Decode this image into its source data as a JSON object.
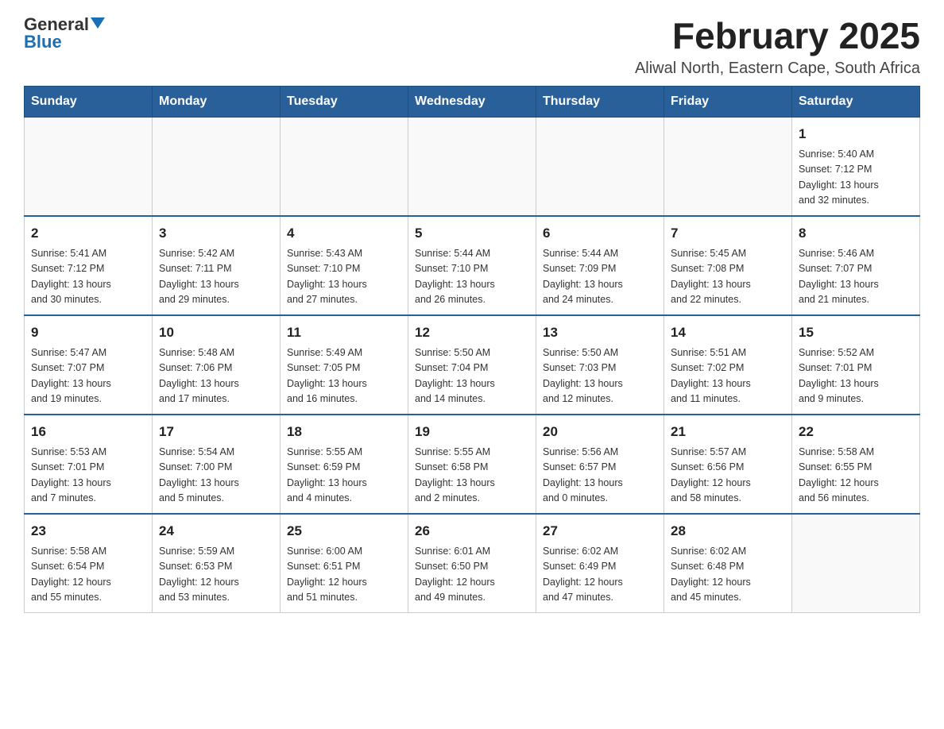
{
  "logo": {
    "general": "General",
    "blue": "Blue"
  },
  "title": "February 2025",
  "subtitle": "Aliwal North, Eastern Cape, South Africa",
  "weekdays": [
    "Sunday",
    "Monday",
    "Tuesday",
    "Wednesday",
    "Thursday",
    "Friday",
    "Saturday"
  ],
  "weeks": [
    [
      {
        "day": "",
        "info": ""
      },
      {
        "day": "",
        "info": ""
      },
      {
        "day": "",
        "info": ""
      },
      {
        "day": "",
        "info": ""
      },
      {
        "day": "",
        "info": ""
      },
      {
        "day": "",
        "info": ""
      },
      {
        "day": "1",
        "info": "Sunrise: 5:40 AM\nSunset: 7:12 PM\nDaylight: 13 hours\nand 32 minutes."
      }
    ],
    [
      {
        "day": "2",
        "info": "Sunrise: 5:41 AM\nSunset: 7:12 PM\nDaylight: 13 hours\nand 30 minutes."
      },
      {
        "day": "3",
        "info": "Sunrise: 5:42 AM\nSunset: 7:11 PM\nDaylight: 13 hours\nand 29 minutes."
      },
      {
        "day": "4",
        "info": "Sunrise: 5:43 AM\nSunset: 7:10 PM\nDaylight: 13 hours\nand 27 minutes."
      },
      {
        "day": "5",
        "info": "Sunrise: 5:44 AM\nSunset: 7:10 PM\nDaylight: 13 hours\nand 26 minutes."
      },
      {
        "day": "6",
        "info": "Sunrise: 5:44 AM\nSunset: 7:09 PM\nDaylight: 13 hours\nand 24 minutes."
      },
      {
        "day": "7",
        "info": "Sunrise: 5:45 AM\nSunset: 7:08 PM\nDaylight: 13 hours\nand 22 minutes."
      },
      {
        "day": "8",
        "info": "Sunrise: 5:46 AM\nSunset: 7:07 PM\nDaylight: 13 hours\nand 21 minutes."
      }
    ],
    [
      {
        "day": "9",
        "info": "Sunrise: 5:47 AM\nSunset: 7:07 PM\nDaylight: 13 hours\nand 19 minutes."
      },
      {
        "day": "10",
        "info": "Sunrise: 5:48 AM\nSunset: 7:06 PM\nDaylight: 13 hours\nand 17 minutes."
      },
      {
        "day": "11",
        "info": "Sunrise: 5:49 AM\nSunset: 7:05 PM\nDaylight: 13 hours\nand 16 minutes."
      },
      {
        "day": "12",
        "info": "Sunrise: 5:50 AM\nSunset: 7:04 PM\nDaylight: 13 hours\nand 14 minutes."
      },
      {
        "day": "13",
        "info": "Sunrise: 5:50 AM\nSunset: 7:03 PM\nDaylight: 13 hours\nand 12 minutes."
      },
      {
        "day": "14",
        "info": "Sunrise: 5:51 AM\nSunset: 7:02 PM\nDaylight: 13 hours\nand 11 minutes."
      },
      {
        "day": "15",
        "info": "Sunrise: 5:52 AM\nSunset: 7:01 PM\nDaylight: 13 hours\nand 9 minutes."
      }
    ],
    [
      {
        "day": "16",
        "info": "Sunrise: 5:53 AM\nSunset: 7:01 PM\nDaylight: 13 hours\nand 7 minutes."
      },
      {
        "day": "17",
        "info": "Sunrise: 5:54 AM\nSunset: 7:00 PM\nDaylight: 13 hours\nand 5 minutes."
      },
      {
        "day": "18",
        "info": "Sunrise: 5:55 AM\nSunset: 6:59 PM\nDaylight: 13 hours\nand 4 minutes."
      },
      {
        "day": "19",
        "info": "Sunrise: 5:55 AM\nSunset: 6:58 PM\nDaylight: 13 hours\nand 2 minutes."
      },
      {
        "day": "20",
        "info": "Sunrise: 5:56 AM\nSunset: 6:57 PM\nDaylight: 13 hours\nand 0 minutes."
      },
      {
        "day": "21",
        "info": "Sunrise: 5:57 AM\nSunset: 6:56 PM\nDaylight: 12 hours\nand 58 minutes."
      },
      {
        "day": "22",
        "info": "Sunrise: 5:58 AM\nSunset: 6:55 PM\nDaylight: 12 hours\nand 56 minutes."
      }
    ],
    [
      {
        "day": "23",
        "info": "Sunrise: 5:58 AM\nSunset: 6:54 PM\nDaylight: 12 hours\nand 55 minutes."
      },
      {
        "day": "24",
        "info": "Sunrise: 5:59 AM\nSunset: 6:53 PM\nDaylight: 12 hours\nand 53 minutes."
      },
      {
        "day": "25",
        "info": "Sunrise: 6:00 AM\nSunset: 6:51 PM\nDaylight: 12 hours\nand 51 minutes."
      },
      {
        "day": "26",
        "info": "Sunrise: 6:01 AM\nSunset: 6:50 PM\nDaylight: 12 hours\nand 49 minutes."
      },
      {
        "day": "27",
        "info": "Sunrise: 6:02 AM\nSunset: 6:49 PM\nDaylight: 12 hours\nand 47 minutes."
      },
      {
        "day": "28",
        "info": "Sunrise: 6:02 AM\nSunset: 6:48 PM\nDaylight: 12 hours\nand 45 minutes."
      },
      {
        "day": "",
        "info": ""
      }
    ]
  ]
}
